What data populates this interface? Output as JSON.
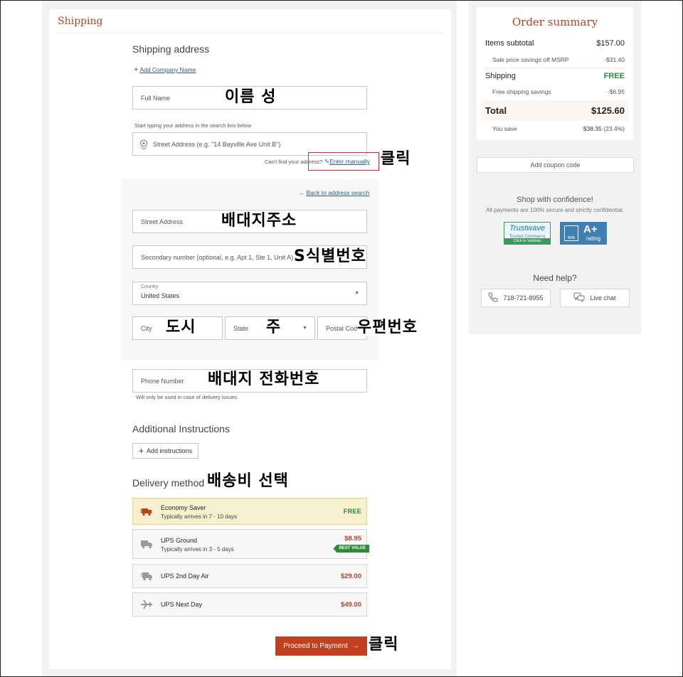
{
  "page": {
    "title": "Shipping"
  },
  "address": {
    "heading": "Shipping address",
    "add_company": "Add Company Name",
    "full_name_placeholder": "Full Name",
    "search_hint": "Start typing your address in the search box below",
    "street_search_placeholder": "Street Address (e.g. \"14 Bayville Ave Unit B\")",
    "cant_find": "Can't find your address?",
    "enter_manually": "Enter manually"
  },
  "manual": {
    "back_link": "Back to address search",
    "street_placeholder": "Street Address",
    "secondary_placeholder": "Secondary number (optional, e.g. Apt 1, Ste 1, Unit A)",
    "country_label": "Country",
    "country_value": "United States",
    "city_placeholder": "City",
    "state_placeholder": "State",
    "postal_placeholder": "Postal Code"
  },
  "phone": {
    "placeholder": "Phone Number",
    "note": "Will only be used in case of delivery issues"
  },
  "instructions": {
    "heading": "Additional Instructions",
    "add_button": "Add instructions"
  },
  "delivery": {
    "heading": "Delivery method",
    "options": [
      {
        "name": "Economy Saver",
        "sub": "Typically arrives in 7 - 10 days",
        "price": "FREE",
        "icon": "economy-truck-icon"
      },
      {
        "name": "UPS Ground",
        "sub": "Typically arrives in 3 - 5 days",
        "price": "$8.95",
        "badge": "BEST VALUE",
        "icon": "truck-icon"
      },
      {
        "name": "UPS 2nd Day Air",
        "sub": "",
        "price": "$29.00",
        "icon": "fast-truck-icon"
      },
      {
        "name": "UPS Next Day",
        "sub": "",
        "price": "$49.00",
        "icon": "airplane-icon"
      }
    ]
  },
  "proceed_button": "Proceed to Payment",
  "annotations": {
    "name": "이름 성",
    "click_manual": "클릭",
    "street": "배대지주소",
    "secondary": "S식별번호",
    "city": "도시",
    "state": "주",
    "postal": "우편번호",
    "phone": "배대지 전화번호",
    "delivery": "배송비 선택",
    "click_proceed": "클릭"
  },
  "summary": {
    "title": "Order summary",
    "items_subtotal_label": "Items subtotal",
    "items_subtotal": "$157.00",
    "msrp_label": "Sale price savings off MSRP",
    "msrp_value": "-$31.40",
    "shipping_label": "Shipping",
    "shipping_value": "FREE",
    "free_ship_label": "Free shipping savings",
    "free_ship_value": "-$6.95",
    "total_label": "Total",
    "total_value": "$125.60",
    "you_save_label": "You save",
    "you_save_value": "$38.35",
    "you_save_pct": "(23.4%)"
  },
  "coupon_label": "Add coupon code",
  "confidence": {
    "heading": "Shop with confidence!",
    "sub": "All payments are 100% secure and strictly confidential.",
    "trustwave_title": "Trustwave",
    "trustwave_sub": "Trusted Commerce",
    "trustwave_cta": "Click to Validate",
    "bbb_grade": "A+",
    "bbb_rating": "rating",
    "bbb_label": "BBB"
  },
  "help": {
    "heading": "Need help?",
    "phone": "718-721-8955",
    "chat": "Live chat"
  },
  "colors": {
    "brand": "#b0442a",
    "proceed": "#c1401f",
    "free_green": "#2f8a3a",
    "price_red": "#b0442a"
  }
}
